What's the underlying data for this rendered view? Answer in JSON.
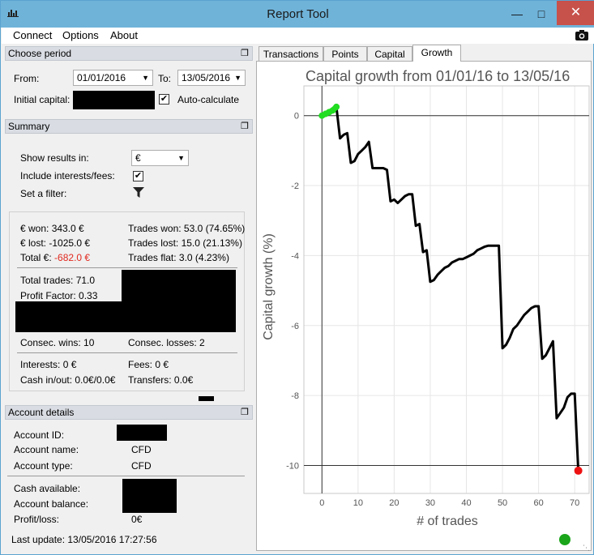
{
  "window": {
    "title": "Report Tool",
    "status_color": "#1aa51a"
  },
  "menu": {
    "items": [
      "Connect",
      "Options",
      "About"
    ]
  },
  "period": {
    "header": "Choose period",
    "from_label": "From:",
    "from_value": "01/01/2016",
    "to_label": "To:",
    "to_value": "13/05/2016",
    "capital_label": "Initial capital:",
    "auto_label": "Auto-calculate"
  },
  "summary": {
    "header": "Summary",
    "show_label": "Show results in:",
    "show_value": "€",
    "include_label": "Include interests/fees:",
    "filter_label": "Set a filter:",
    "won": "€ won: 343.0 €",
    "lost": "€ lost: -1025.0 €",
    "total_prefix": "Total €:",
    "total_value": "-682.0 €",
    "total_color": "#e0281e",
    "trades_won": "Trades won: 53.0 (74.65%)",
    "trades_lost": "Trades lost: 15.0 (21.13%)",
    "trades_flat": "Trades flat: 3.0 (4.23%)",
    "total_trades": "Total trades: 71.0",
    "profit_factor": "Profit Factor: 0.33",
    "consec_wins": "Consec. wins: 10",
    "consec_losses": "Consec. losses: 2",
    "interests": "Interests: 0 €",
    "fees": "Fees: 0 €",
    "cash_inout": "Cash in/out: 0.0€/0.0€",
    "transfers": "Transfers: 0.0€"
  },
  "account": {
    "header": "Account details",
    "id_label": "Account ID:",
    "name_label": "Account name:",
    "name_value": "CFD",
    "type_label": "Account type:",
    "type_value": "CFD",
    "cash_label": "Cash available:",
    "balance_label": "Account balance:",
    "pl_label": "Profit/loss:",
    "pl_value": "0€"
  },
  "status": {
    "last_update": "Last update: 13/05/2016 17:27:56"
  },
  "tabs": [
    "Transactions",
    "Points",
    "Capital",
    "Growth"
  ],
  "active_tab": "Growth",
  "chart_data": {
    "type": "line",
    "title": "Capital growth from 01/01/16 to 13/05/16",
    "xlabel": "# of trades",
    "ylabel": "Capital growth (%)",
    "xlim": [
      -5,
      74
    ],
    "ylim": [
      -10.8,
      0.85
    ],
    "xticks": [
      0,
      10,
      20,
      30,
      40,
      50,
      60,
      70
    ],
    "yticks": [
      0,
      -2,
      -4,
      -6,
      -8,
      -10
    ],
    "grid": true,
    "line_color": "#000000",
    "highlight_color": "#22dd22",
    "end_marker_color": "#ee1111",
    "highlight_x": [
      0,
      1,
      2,
      3,
      4
    ],
    "x": [
      0,
      1,
      2,
      3,
      4,
      5,
      6,
      7,
      8,
      9,
      10,
      11,
      12,
      13,
      14,
      15,
      16,
      17,
      18,
      19,
      20,
      21,
      22,
      23,
      24,
      25,
      26,
      27,
      28,
      29,
      30,
      31,
      32,
      33,
      34,
      35,
      36,
      37,
      38,
      39,
      40,
      41,
      42,
      43,
      44,
      45,
      46,
      47,
      48,
      49,
      50,
      51,
      52,
      53,
      54,
      55,
      56,
      57,
      58,
      59,
      60,
      61,
      62,
      63,
      64,
      65,
      66,
      67,
      68,
      69,
      70,
      71
    ],
    "y": [
      0,
      0.05,
      0.1,
      0.15,
      0.25,
      -0.65,
      -0.55,
      -0.5,
      -1.35,
      -1.3,
      -1.1,
      -1.0,
      -0.9,
      -0.75,
      -1.5,
      -1.5,
      -1.5,
      -1.5,
      -1.55,
      -2.45,
      -2.4,
      -2.5,
      -2.4,
      -2.3,
      -2.25,
      -2.25,
      -3.15,
      -3.1,
      -3.9,
      -3.85,
      -4.75,
      -4.7,
      -4.55,
      -4.45,
      -4.35,
      -4.3,
      -4.2,
      -4.15,
      -4.1,
      -4.1,
      -4.05,
      -4.0,
      -3.95,
      -3.85,
      -3.8,
      -3.75,
      -3.72,
      -3.72,
      -3.72,
      -3.72,
      -6.65,
      -6.55,
      -6.35,
      -6.1,
      -6.0,
      -5.85,
      -5.7,
      -5.6,
      -5.5,
      -5.45,
      -5.45,
      -6.95,
      -6.85,
      -6.65,
      -6.45,
      -8.65,
      -8.5,
      -8.35,
      -8.05,
      -7.95,
      -7.95,
      -10.15
    ]
  }
}
